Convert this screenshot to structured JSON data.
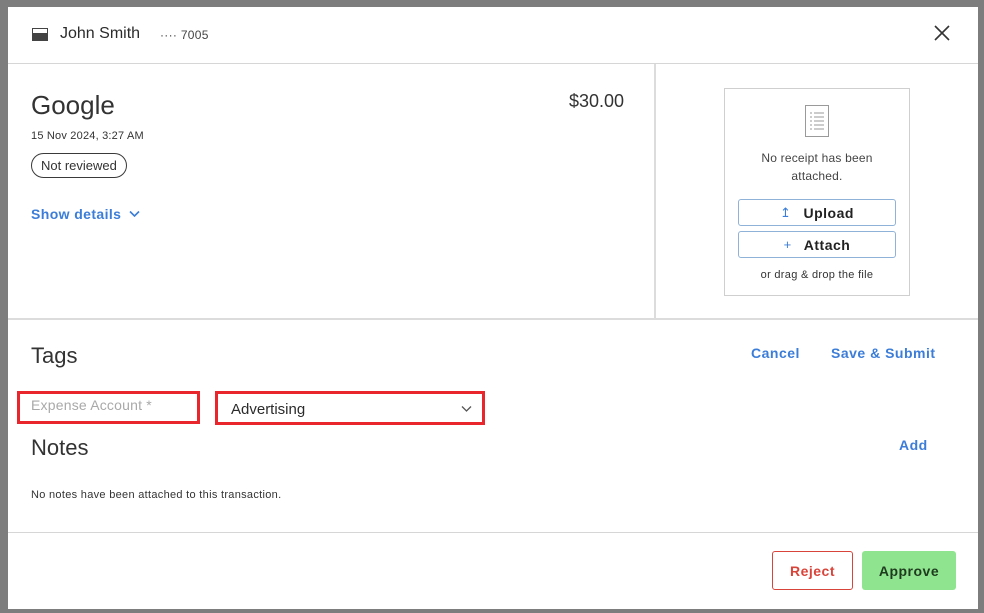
{
  "header": {
    "card_icon": "card-icon",
    "cardholder": "John Smith",
    "card_masked": "···· 7005",
    "close_icon": "close-icon"
  },
  "transaction": {
    "merchant": "Google",
    "datetime": "15 Nov 2024, 3:27 AM",
    "amount": "$30.00",
    "status": "Not reviewed",
    "show_details_label": "Show details",
    "show_details_icon": "chevron-down-icon"
  },
  "receipt": {
    "icon": "document-icon",
    "empty_text": "No receipt has been attached.",
    "upload_label": "Upload",
    "upload_icon": "↥",
    "attach_label": "Attach",
    "attach_icon": "+",
    "drag_hint": "or drag & drop the file"
  },
  "tags": {
    "title": "Tags",
    "cancel_label": "Cancel",
    "save_submit_label": "Save & Submit",
    "expense_account_label": "Expense Account *",
    "expense_account_value": "Advertising",
    "highlight_color": "#e8262b"
  },
  "notes": {
    "title": "Notes",
    "add_label": "Add",
    "empty_text": "No notes have been attached to this transaction."
  },
  "footer": {
    "reject_label": "Reject",
    "approve_label": "Approve",
    "reject_color": "#d9443a",
    "approve_color": "#8fe58f"
  },
  "colors": {
    "accent": "#3b7dd8",
    "overlay": "#7d7d7d"
  }
}
